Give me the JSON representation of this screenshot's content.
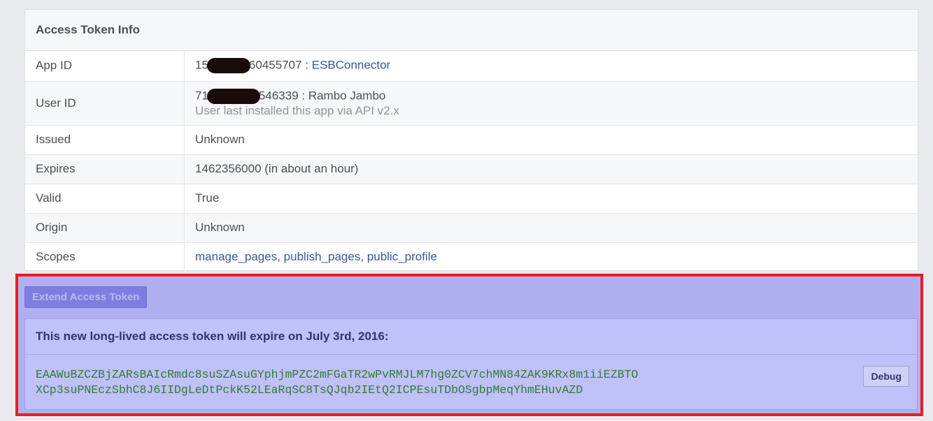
{
  "panel": {
    "title": "Access Token Info",
    "rows": {
      "app_id": {
        "label": "App ID",
        "id_prefix": "15",
        "id_suffix": "60455707 : ",
        "app_name": "ESBConnector"
      },
      "user_id": {
        "label": "User ID",
        "id_prefix": "71",
        "id_suffix": "546339 : Rambo Jambo",
        "note": "User last installed this app via API v2.x"
      },
      "issued": {
        "label": "Issued",
        "value": "Unknown"
      },
      "expires": {
        "label": "Expires",
        "value": "1462356000 (in about an hour)"
      },
      "valid": {
        "label": "Valid",
        "value": "True"
      },
      "origin": {
        "label": "Origin",
        "value": "Unknown"
      },
      "scopes": {
        "label": "Scopes",
        "items": [
          "manage_pages",
          "publish_pages",
          "public_profile"
        ],
        "sep": ", "
      }
    }
  },
  "extend": {
    "button_label": "Extend Access Token",
    "result_title": "This new long-lived access token will expire on July 3rd, 2016:",
    "token_line1": "EAAWuBZCZBjZARsBAIcRmdc8suSZAsuGYphjmPZC2mFGaTR2wPvRMJLM7hg0ZCV7chMN84ZAK9KRx8m1iiEZBTO",
    "token_line2": "XCp3suPNEczSbhC8J6IIDgLeDtPckK52LEaRqSC8TsQJqb2IEtQ2ICPEsuTDbOSgbpMeqYhmEHuvAZD",
    "debug_label": "Debug"
  },
  "colors": {
    "highlight_border": "#ec1c24",
    "link": "#365899",
    "token_text": "#2e7d32"
  }
}
